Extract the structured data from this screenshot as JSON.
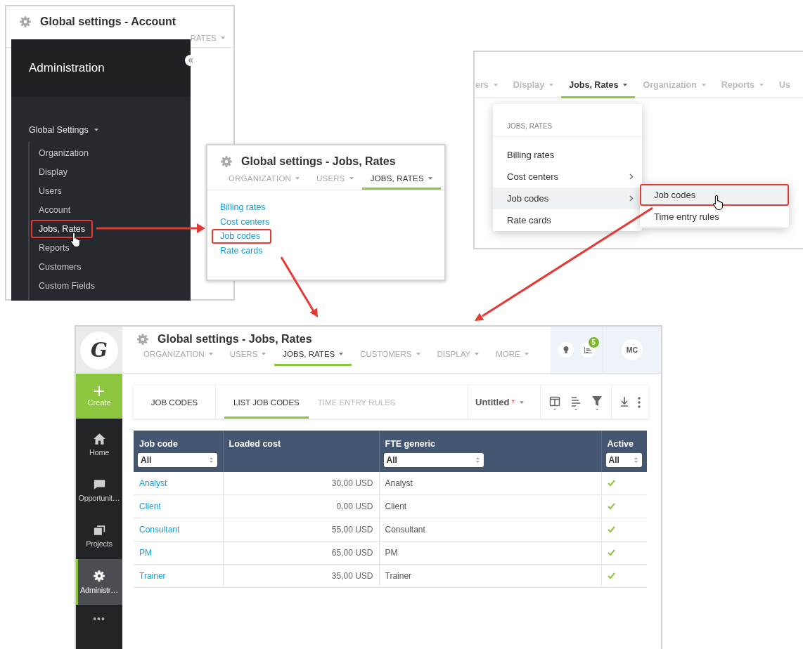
{
  "account_window": {
    "title": "Global settings - Account",
    "visible_tab": "RATES"
  },
  "admin_panel": {
    "title": "Administration",
    "section": "Global Settings",
    "items": [
      {
        "label": "Organization",
        "highlighted": false
      },
      {
        "label": "Display",
        "highlighted": false
      },
      {
        "label": "Users",
        "highlighted": false
      },
      {
        "label": "Account",
        "highlighted": false
      },
      {
        "label": "Jobs, Rates",
        "highlighted": true
      },
      {
        "label": "Reports",
        "highlighted": false
      },
      {
        "label": "Customers",
        "highlighted": false
      },
      {
        "label": "Custom Fields",
        "highlighted": false
      }
    ]
  },
  "jobs_rates_window": {
    "title": "Global settings - Jobs, Rates",
    "tabs": [
      {
        "label": "ORGANIZATION",
        "selected": false
      },
      {
        "label": "USERS",
        "selected": false
      },
      {
        "label": "JOBS, RATES",
        "selected": true
      }
    ],
    "links": [
      {
        "label": "Billing rates",
        "highlighted": false
      },
      {
        "label": "Cost centers",
        "highlighted": false
      },
      {
        "label": "Job codes",
        "highlighted": true
      },
      {
        "label": "Rate cards",
        "highlighted": false
      }
    ]
  },
  "menu_window": {
    "tabs": [
      {
        "label": "ers",
        "selected": false,
        "caret": true
      },
      {
        "label": "Display",
        "selected": false,
        "caret": true
      },
      {
        "label": "Jobs, Rates",
        "selected": true,
        "caret": true
      },
      {
        "label": "Organization",
        "selected": false,
        "caret": true
      },
      {
        "label": "Reports",
        "selected": false,
        "caret": true
      },
      {
        "label": "Us",
        "selected": false,
        "caret": false
      }
    ],
    "dropdown": {
      "header": "JOBS, RATES",
      "items": [
        {
          "label": "Billing rates",
          "submenu": false,
          "selected": false
        },
        {
          "label": "Cost centers",
          "submenu": true,
          "selected": false
        },
        {
          "label": "Job codes",
          "submenu": true,
          "selected": true
        },
        {
          "label": "Rate cards",
          "submenu": false,
          "selected": false
        }
      ]
    },
    "submenu": {
      "items": [
        {
          "label": "Job codes",
          "selected": true,
          "highlighted": true
        },
        {
          "label": "Time entry rules",
          "selected": false,
          "highlighted": false
        }
      ]
    }
  },
  "app": {
    "logo": "G",
    "create_label": "Create",
    "nav": [
      {
        "label": "Home",
        "kind": "home",
        "selected": false
      },
      {
        "label": "Opportunit…",
        "kind": "chat",
        "selected": false
      },
      {
        "label": "Projects",
        "kind": "projects",
        "selected": false
      },
      {
        "label": "Administr…",
        "kind": "gear",
        "selected": true
      }
    ],
    "more": "•••",
    "title": "Global settings - Jobs, Rates",
    "tabs": [
      {
        "label": "ORGANIZATION",
        "selected": false
      },
      {
        "label": "USERS",
        "selected": false
      },
      {
        "label": "JOBS, RATES",
        "selected": true
      },
      {
        "label": "CUSTOMERS",
        "selected": false
      },
      {
        "label": "DISPLAY",
        "selected": false
      },
      {
        "label": "MORE",
        "selected": false
      }
    ],
    "notification_count": "5",
    "avatar": "MC",
    "toolbar": {
      "section": "JOB CODES",
      "tabs": [
        {
          "label": "LIST JOB CODES",
          "selected": true
        },
        {
          "label": "TIME ENTRY RULES",
          "selected": false
        }
      ],
      "view_name": "Untitled",
      "modified_mark": "*"
    },
    "table": {
      "columns": [
        {
          "label": "Job code",
          "filter": "All"
        },
        {
          "label": "Loaded cost"
        },
        {
          "label": "FTE generic",
          "filter": "All"
        },
        {
          "label": "Active",
          "filter": "All"
        }
      ],
      "rows": [
        {
          "job_code": "Analyst",
          "loaded_cost": "30,00 USD",
          "fte_generic": "Analyst",
          "active": true
        },
        {
          "job_code": "Client",
          "loaded_cost": "0,00 USD",
          "fte_generic": "Client",
          "active": true
        },
        {
          "job_code": "Consultant",
          "loaded_cost": "55,00 USD",
          "fte_generic": "Consultant",
          "active": true
        },
        {
          "job_code": "PM",
          "loaded_cost": "65,00 USD",
          "fte_generic": "PM",
          "active": true
        },
        {
          "job_code": "Trainer",
          "loaded_cost": "35,00 USD",
          "fte_generic": "Trainer",
          "active": true
        }
      ]
    }
  }
}
